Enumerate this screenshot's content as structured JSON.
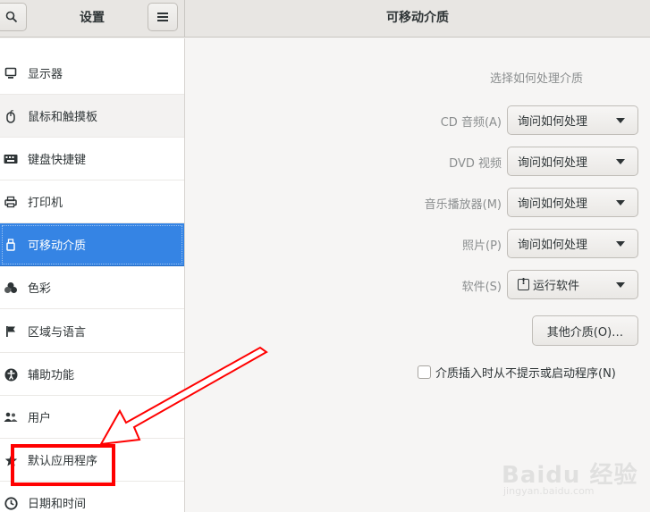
{
  "header": {
    "sidebar_title": "设置",
    "content_title": "可移动介质",
    "search_icon": "search-icon",
    "menu_icon": "hamburger-menu-icon"
  },
  "sidebar": {
    "items": [
      {
        "label": "显示器",
        "icon": "display-icon"
      },
      {
        "label": "鼠标和触摸板",
        "icon": "mouse-icon"
      },
      {
        "label": "键盘快捷键",
        "icon": "keyboard-icon"
      },
      {
        "label": "打印机",
        "icon": "printer-icon"
      },
      {
        "label": "可移动介质",
        "icon": "usb-drive-icon",
        "selected": true
      },
      {
        "label": "色彩",
        "icon": "color-icon"
      },
      {
        "label": "区域与语言",
        "icon": "flag-icon"
      },
      {
        "label": "辅助功能",
        "icon": "accessibility-icon"
      },
      {
        "label": "用户",
        "icon": "users-icon"
      },
      {
        "label": "默认应用程序",
        "icon": "star-icon"
      },
      {
        "label": "日期和时间",
        "icon": "clock-icon"
      }
    ]
  },
  "content": {
    "heading": "选择如何处理介质",
    "rows": [
      {
        "label": "CD 音频(A)",
        "value": "询问如何处理"
      },
      {
        "label": "DVD 视频",
        "value": "询问如何处理"
      },
      {
        "label": "音乐播放器(M)",
        "value": "询问如何处理"
      },
      {
        "label": "照片(P)",
        "value": "询问如何处理"
      },
      {
        "label": "软件(S)",
        "value": "运行软件",
        "icon": "warning-icon"
      }
    ],
    "other_media_button": "其他介质(O)…",
    "never_prompt_label": "介质插入时从不提示或启动程序(N)",
    "never_prompt_checked": false
  },
  "colors": {
    "accent": "#3584e4",
    "annotation": "#ff0000"
  },
  "watermark": {
    "text": "Baidu 经验",
    "url": "jingyan.baidu.com"
  }
}
